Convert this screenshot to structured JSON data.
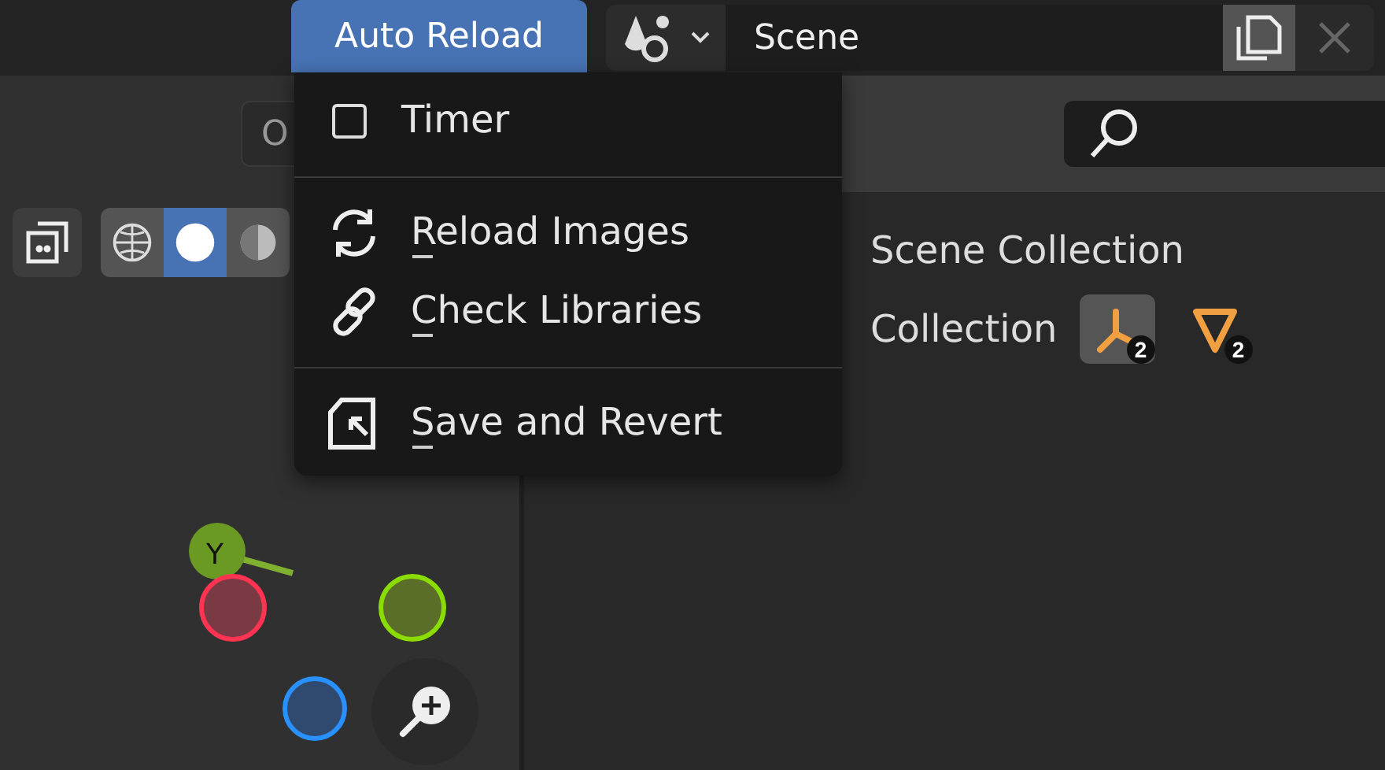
{
  "header": {
    "auto_reload": "Auto Reload",
    "scene_field": "Scene"
  },
  "viewport": {
    "options_button": "O",
    "shading": [
      {
        "kind": "wireframe",
        "selected": false
      },
      {
        "kind": "solid",
        "selected": true
      },
      {
        "kind": "material",
        "selected": false
      }
    ],
    "gizmo_label": "Y"
  },
  "outliner": {
    "rows": [
      {
        "label": "Scene Collection",
        "badges": []
      },
      {
        "label": "Collection",
        "badges": [
          {
            "kind": "armature",
            "count": "2",
            "selected": true
          },
          {
            "kind": "mesh",
            "count": "2",
            "selected": false
          }
        ]
      }
    ]
  },
  "menu": {
    "items": [
      {
        "kind": "checkbox",
        "label": "Timer",
        "checked": false,
        "mnemonic": false
      },
      {
        "kind": "separator"
      },
      {
        "kind": "reload",
        "label": "Reload Images",
        "mnemonic": true
      },
      {
        "kind": "link",
        "label": "Check Libraries",
        "mnemonic": true
      },
      {
        "kind": "separator"
      },
      {
        "kind": "revert",
        "label": "Save and Revert",
        "mnemonic": true
      }
    ]
  }
}
